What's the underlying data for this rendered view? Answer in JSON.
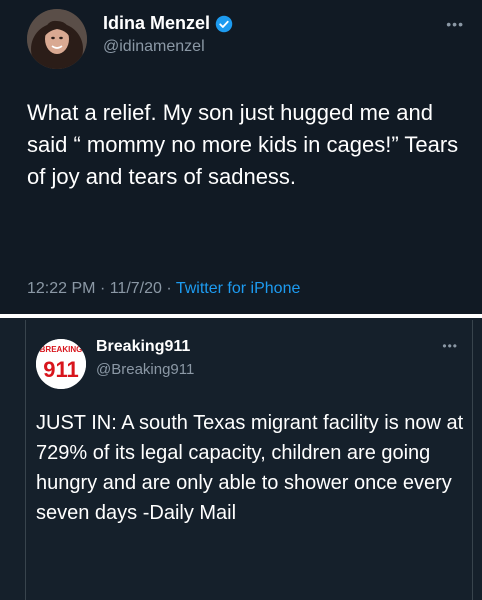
{
  "tweet": {
    "author_name": "Idina Menzel",
    "handle": "@idinamenzel",
    "text": "What a relief.  My son just hugged me and said “ mommy no more kids in cages!” Tears of joy and tears of sadness.",
    "time": "12:22 PM",
    "date": "11/7/20",
    "separator": "·",
    "source": "Twitter for iPhone",
    "more_icon": "•••"
  },
  "quoted": {
    "author_name": "Breaking911",
    "handle": "@Breaking911",
    "text": "JUST IN: A south Texas migrant facility is now at 729% of its legal capacity, children are going hungry and are only able to shower once every seven days -Daily Mail",
    "avatar_top": "BREAKING",
    "avatar_number": "911",
    "more_icon": "•••"
  },
  "colors": {
    "background": "#15202b",
    "muted": "#8b98a5",
    "link": "#1d9bf0",
    "verified": "#1d9bf0",
    "logo_red": "#d8151c"
  }
}
